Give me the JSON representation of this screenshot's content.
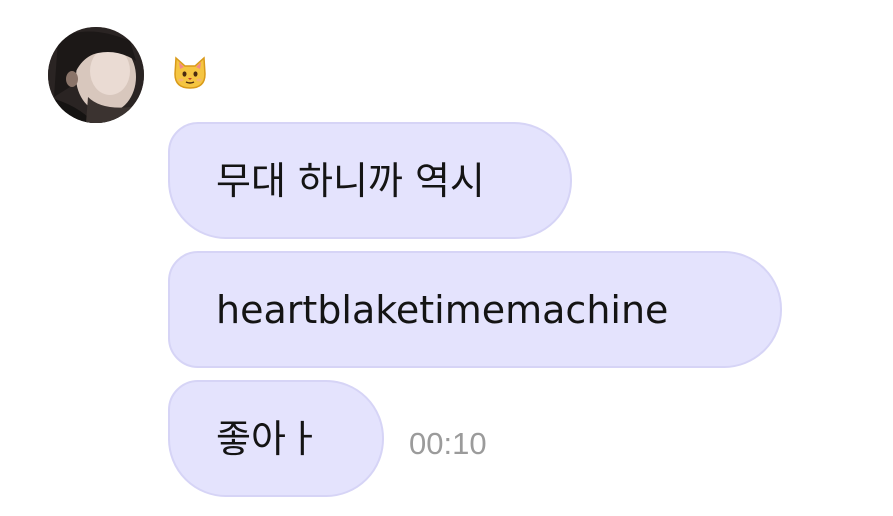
{
  "chat": {
    "sender": {
      "avatar_icon": "profile-photo",
      "name_emoji": "🐱"
    },
    "messages": [
      {
        "text": "무대 하니까 역시"
      },
      {
        "text": "heartblaketimemachine"
      },
      {
        "text": "좋아ㅏ",
        "time": "00:10"
      }
    ]
  },
  "colors": {
    "bubble_bg": "#e4e3fd",
    "bubble_border": "#d6d4f6",
    "text": "#141414",
    "timestamp": "#9b9b9b"
  }
}
